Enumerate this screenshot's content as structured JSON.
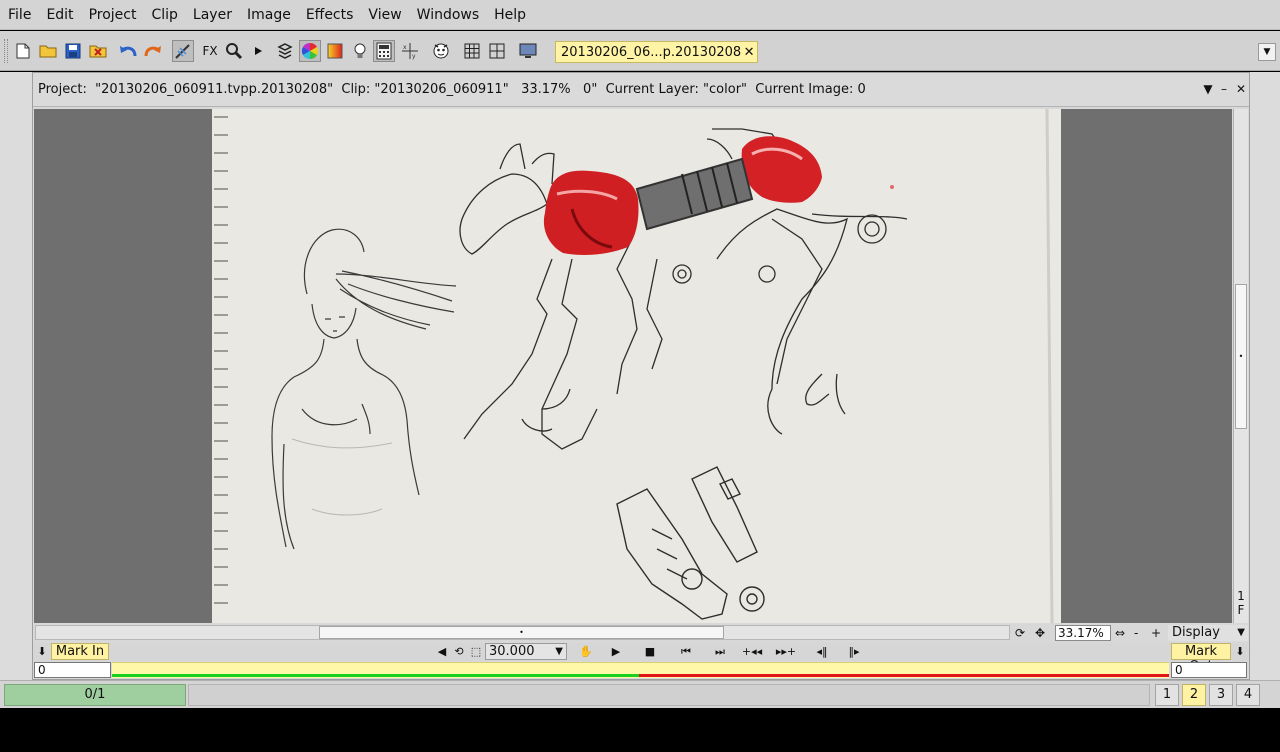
{
  "menu": [
    "File",
    "Edit",
    "Project",
    "Clip",
    "Layer",
    "Image",
    "Effects",
    "View",
    "Windows",
    "Help"
  ],
  "toolbar": {
    "fx_label": "FX",
    "doc_tab": "20130206_06...p.20130208",
    "doc_tab_close": "✕",
    "dropdown": "▼",
    "icons": [
      "new-file-icon",
      "open-folder-icon",
      "save-icon",
      "close-project-icon",
      "undo-icon",
      "redo-icon",
      "brush-tool-icon",
      "effects-icon",
      "zoom-icon",
      "play-triangle-icon",
      "layers-icon",
      "color-wheel-icon",
      "gradient-icon",
      "lightbulb-icon",
      "calculator-icon",
      "xy-panel-icon",
      "character-icon",
      "grid-icon",
      "layout-icon",
      "monitor-icon"
    ]
  },
  "project": {
    "info": "Project:  \"20130206_060911.tvpp.20130208\"  Clip: \"20130206_060911\"   33.17%   0\"  Current Layer: \"color\"  Current Image: 0",
    "ctrl_menu": "▼",
    "ctrl_min": "–",
    "ctrl_close": "✕",
    "frame_indicator": "1\nF"
  },
  "view": {
    "zoom": "33.17%",
    "zoom_minus": "-",
    "zoom_plus": "+",
    "display_label": "Display",
    "display_arrow": "▼"
  },
  "transport": {
    "mark_in": "Mark In",
    "mark_out": "Mark Out",
    "fps": "30.000",
    "fps_arrow": "▼",
    "mark_in_value": "0",
    "mark_out_value": "0",
    "progress_fraction": 0.4986
  },
  "status": {
    "counter": "0/1",
    "pages": [
      "1",
      "2",
      "3",
      "4"
    ],
    "active_page": "2"
  },
  "colors": {
    "accent_yellow": "#fff2a3",
    "counter_green": "#9fcf9f",
    "timeline_green": "#1ed01e",
    "timeline_red": "#e01515",
    "robot_red": "#d32020"
  }
}
